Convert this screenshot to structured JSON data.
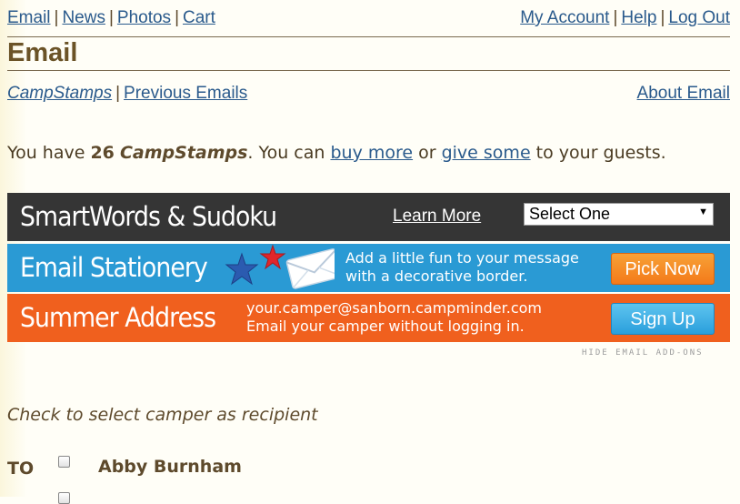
{
  "topnav": {
    "left": [
      "Email",
      "News",
      "Photos",
      "Cart"
    ],
    "right": [
      "My Account",
      "Help",
      "Log Out"
    ],
    "separator": "|"
  },
  "page_title": "Email",
  "subnav": {
    "campstamps": "CampStamps",
    "previous": "Previous Emails",
    "about": "About Email"
  },
  "stamps": {
    "prefix": "You have ",
    "count": "26",
    "name": "CampStamps",
    "mid": ". You can ",
    "buy": "buy more",
    "or": " or ",
    "give": "give some",
    "suffix": " to your guests."
  },
  "banners": {
    "smartwords": {
      "title": "SmartWords & Sudoku",
      "learn_more": "Learn More",
      "select_value": "Select One"
    },
    "stationery": {
      "title": "Email Stationery",
      "line1": "Add a little fun to your message",
      "line2": "with a decorative border.",
      "button": "Pick Now"
    },
    "summer": {
      "title": "Summer Address",
      "line1": "your.camper@sanborn.campminder.com",
      "line2": "Email your camper without logging in.",
      "button": "Sign Up"
    }
  },
  "hide_addons": "HIDE EMAIL ADD-ONS",
  "recipients": {
    "instruction": "Check to select camper as recipient",
    "to_label": "TO",
    "campers": [
      "Abby Burnham"
    ]
  },
  "colors": {
    "link": "#2a5a8c",
    "text": "#5e4a2c",
    "banner_dark": "#353535",
    "banner_blue": "#2a9ad4",
    "banner_orange": "#f0601e"
  }
}
